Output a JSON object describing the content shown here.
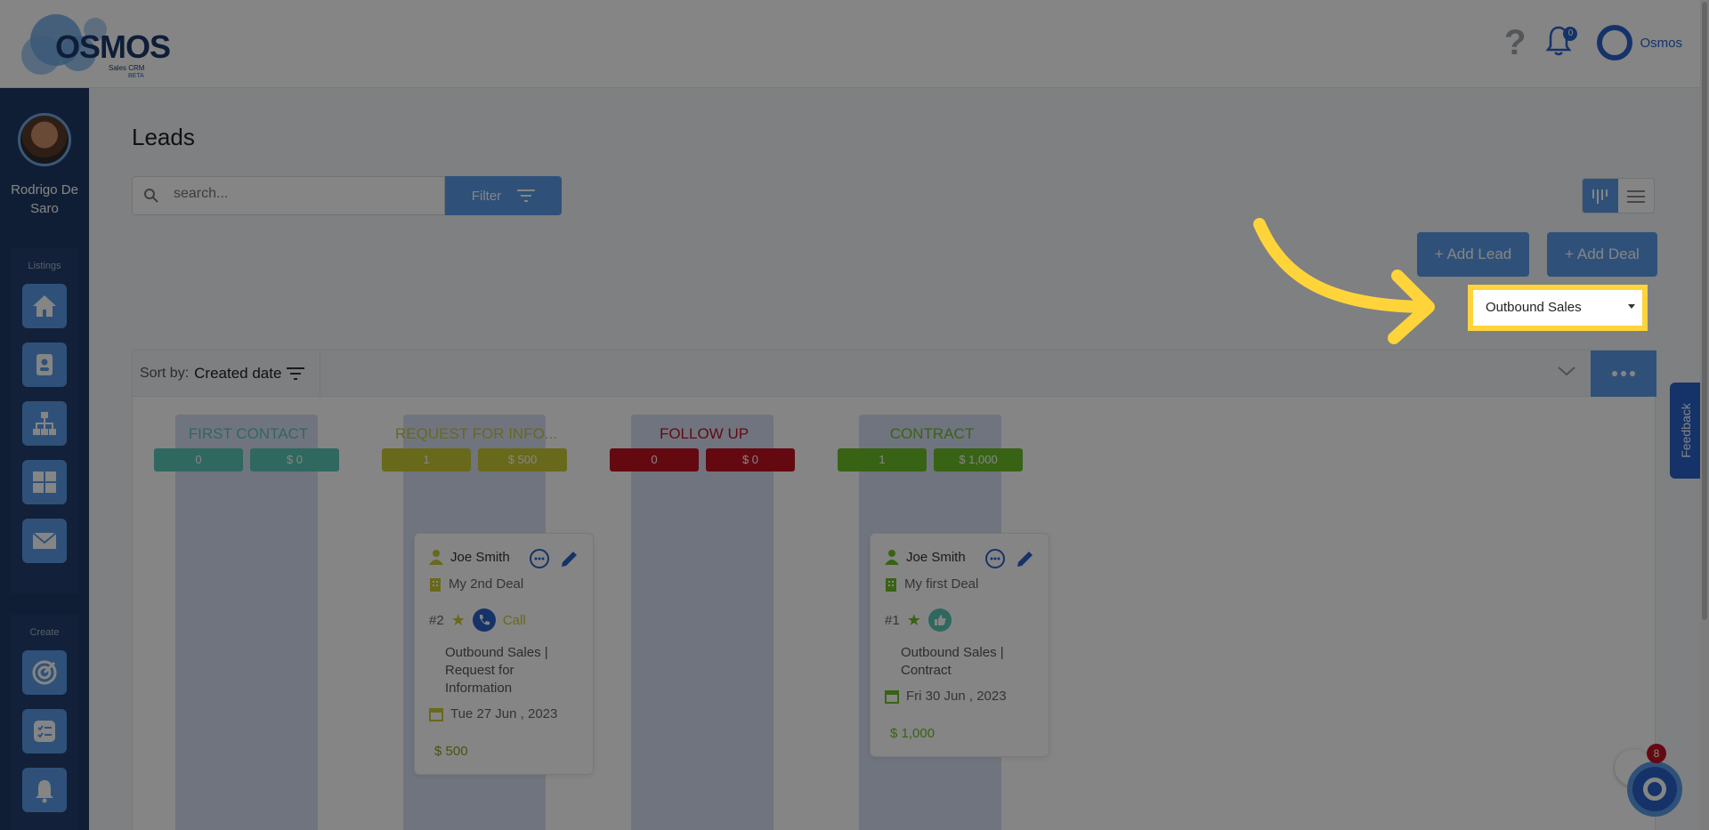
{
  "app": {
    "logo_text": "OSMOS",
    "logo_sub": "Sales CRM",
    "logo_beta": "BETA",
    "help_icon": "question-icon",
    "notifications_count": "0",
    "account_name": "Osmos"
  },
  "sidebar": {
    "user_name": "Rodrigo De Saro",
    "listings_label": "Listings",
    "create_label": "Create",
    "listings": [
      "home-icon",
      "contact-card-icon",
      "org-chart-icon",
      "dashboard-icon",
      "mail-icon"
    ],
    "create": [
      "target-icon",
      "checklist-icon",
      "alarm-icon"
    ]
  },
  "page": {
    "title": "Leads",
    "search_placeholder": "search...",
    "filter_label": "Filter",
    "add_lead": "+ Add Lead",
    "add_deal": "+ Add Deal",
    "pipeline": "Outbound Sales",
    "sort_prefix": "Sort by:",
    "sort_value": "Created date",
    "feedback": "Feedback",
    "chat_badge": "8"
  },
  "columns": [
    {
      "title": "FIRST CONTACT",
      "count": "0",
      "amount": "$ 0",
      "color": "#5ac8b7"
    },
    {
      "title": "REQUEST FOR INFO...",
      "count": "1",
      "amount": "$ 500",
      "color": "#c7c934"
    },
    {
      "title": "FOLLOW UP",
      "count": "0",
      "amount": "$ 0",
      "color": "#c1121f"
    },
    {
      "title": "CONTRACT",
      "count": "1",
      "amount": "$ 1,000",
      "color": "#6cbf2a"
    }
  ],
  "cards": [
    {
      "contact": "Joe Smith",
      "deal": "My 2nd Deal",
      "rank": "#2",
      "action": "Call",
      "stage": "Outbound Sales | Request for Information",
      "date": "Tue 27 Jun , 2023",
      "amount": "$ 500"
    },
    {
      "contact": "Joe Smith",
      "deal": "My first Deal",
      "rank": "#1",
      "stage": "Outbound Sales | Contract",
      "date": "Fri 30 Jun , 2023",
      "amount": "$ 1,000"
    }
  ]
}
